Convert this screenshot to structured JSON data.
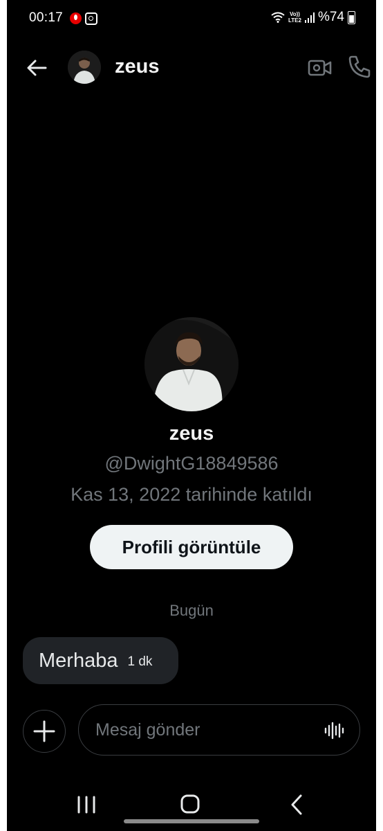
{
  "status_bar": {
    "time": "00:17",
    "network_top": "Vo))",
    "network_bottom": "LTE2",
    "battery": "%74",
    "icons": [
      "vodafone-icon",
      "instagram-icon",
      "wifi-icon",
      "signal-icon",
      "battery-icon"
    ]
  },
  "header": {
    "name": "zeus",
    "icons": [
      "back-arrow-icon",
      "video-camera-icon",
      "phone-icon"
    ]
  },
  "profile": {
    "name": "zeus",
    "handle": "@DwightG18849586",
    "joined": "Kas 13, 2022 tarihinde katıldı",
    "view_profile_label": "Profili görüntüle"
  },
  "conversation": {
    "date_divider": "Bugün",
    "messages": [
      {
        "text": "Merhaba",
        "time": "1 dk"
      }
    ]
  },
  "composer": {
    "placeholder": "Mesaj gönder",
    "icons": [
      "plus-icon",
      "voice-wave-icon"
    ]
  },
  "nav_bar": {
    "icons": [
      "recents-icon",
      "home-icon",
      "back-chevron-icon"
    ]
  },
  "colors": {
    "background": "#000000",
    "text_primary": "#e7e9ea",
    "text_secondary": "#71767b",
    "bubble": "#202327",
    "button_bg": "#eff3f4"
  }
}
